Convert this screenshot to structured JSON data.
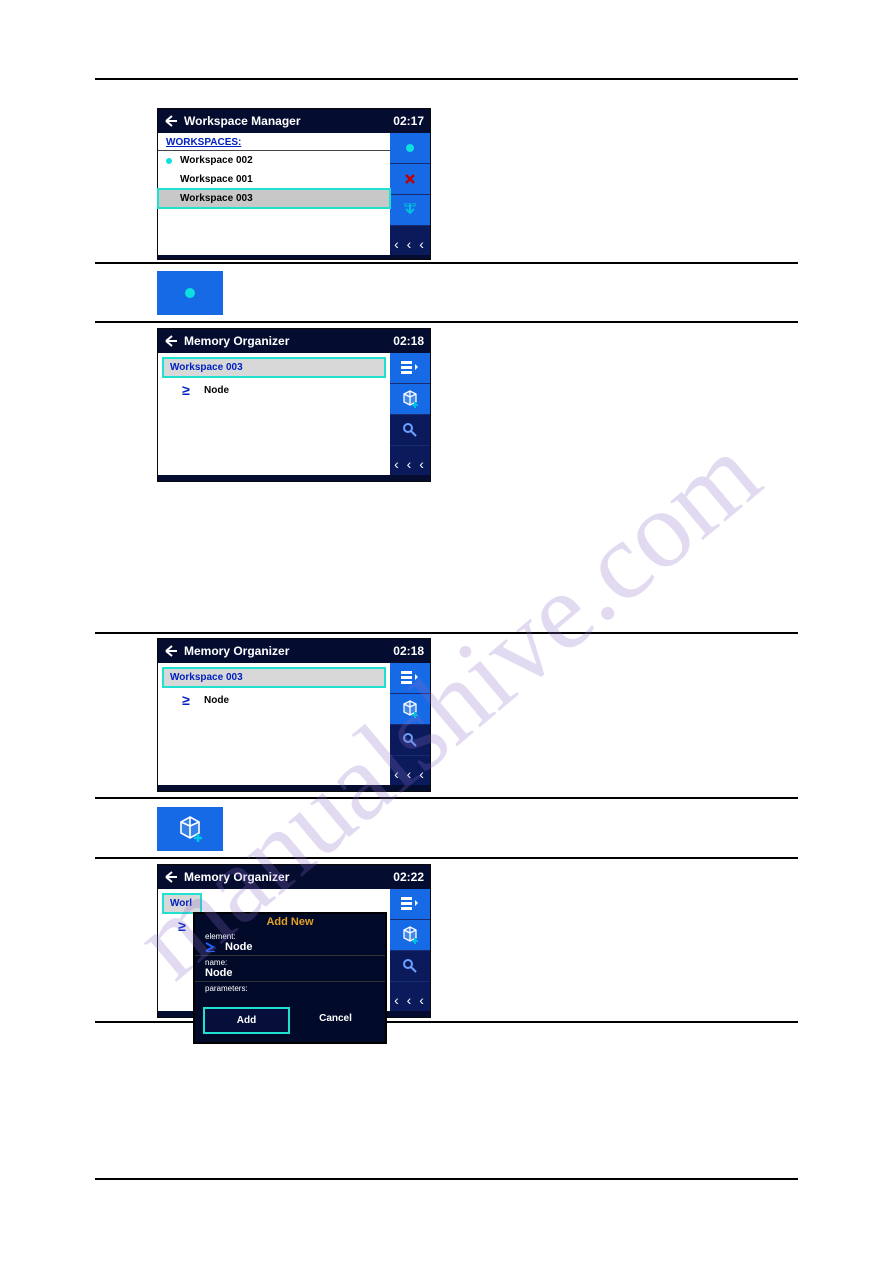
{
  "watermark": "manualshive.com",
  "screen1": {
    "title": "Workspace Manager",
    "time": "02:17",
    "listHeader": "WORKSPACES:",
    "items": [
      {
        "label": "Workspace 002"
      },
      {
        "label": "Workspace 001"
      },
      {
        "label": "Workspace 003"
      }
    ],
    "pager": "‹ ‹ ‹"
  },
  "screen2": {
    "title": "Memory Organizer",
    "time": "02:18",
    "workspace": "Workspace 003",
    "node": "Node",
    "pager": "‹ ‹ ‹"
  },
  "screen3": {
    "title": "Memory Organizer",
    "time": "02:18",
    "workspace": "Workspace 003",
    "node": "Node",
    "pager": "‹ ‹ ‹"
  },
  "screen4": {
    "title": "Memory Organizer",
    "time": "02:22",
    "workspacePartial": "Worl",
    "dialog": {
      "title": "Add New",
      "elementLabel": "element:",
      "elementValue": "Node",
      "nameLabel": "name:",
      "nameValue": "Node",
      "parametersLabel": "parameters:",
      "add": "Add",
      "cancel": "Cancel"
    },
    "pager": "‹ ‹ ‹"
  }
}
